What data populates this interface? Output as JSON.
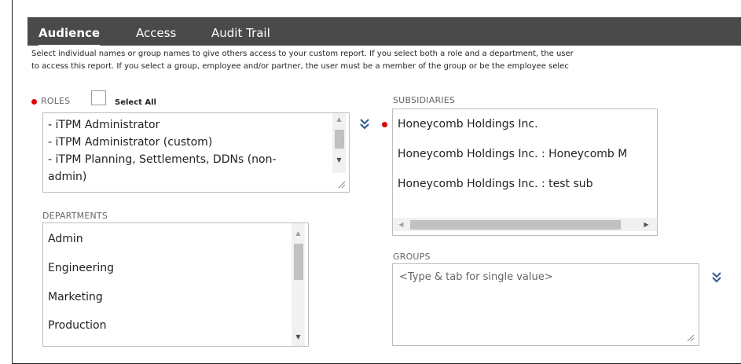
{
  "tabs": [
    {
      "label": "Audience",
      "active": true
    },
    {
      "label": "Access",
      "active": false
    },
    {
      "label": "Audit Trail",
      "active": false
    }
  ],
  "help_lines": [
    "Select individual names or group names to give others access to your custom report. If you select both a role and a department, the user",
    "to access this report. If you select a group, employee and/or partner, the user must be a member of the group or be the employee selec"
  ],
  "roles": {
    "label": "ROLES",
    "select_all_label": "Select All",
    "items": [
      "- iTPM Administrator",
      "- iTPM Administrator (custom)",
      "- iTPM Planning, Settlements, DDNs (non-",
      "admin)"
    ]
  },
  "subsidiaries": {
    "label": "SUBSIDIARIES",
    "items": [
      "Honeycomb Holdings Inc.",
      "Honeycomb Holdings Inc. : Honeycomb M",
      "Honeycomb Holdings Inc. : test sub"
    ]
  },
  "departments": {
    "label": "DEPARTMENTS",
    "items": [
      "Admin",
      "Engineering",
      "Marketing",
      "Production"
    ]
  },
  "groups": {
    "label": "GROUPS",
    "placeholder": "<Type & tab for single value>"
  },
  "colors": {
    "tabbar_bg": "#4a4a4a",
    "required_dot": "#e00000",
    "chevron": "#3a5f8f"
  }
}
